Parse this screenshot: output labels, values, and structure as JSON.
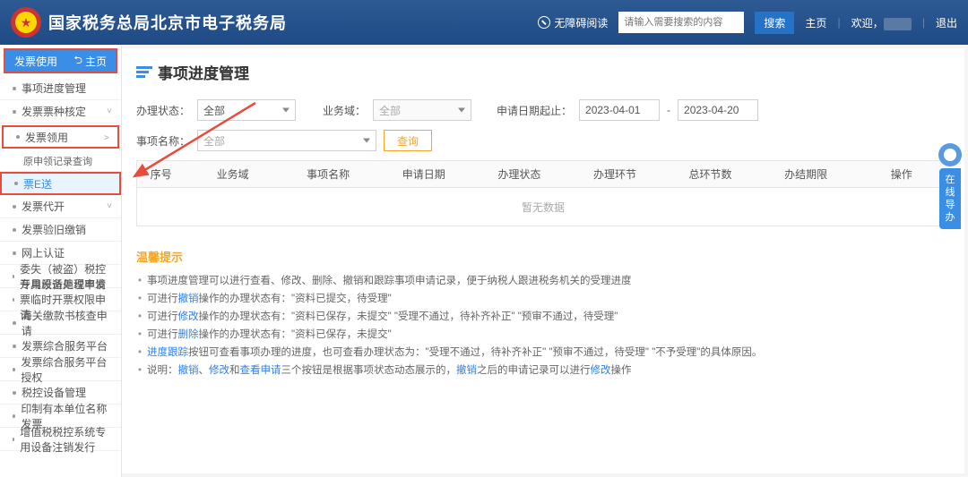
{
  "header": {
    "title": "国家税务总局北京市电子税务局",
    "wza": "无障碍阅读",
    "search_placeholder": "请输入需要搜索的内容",
    "search_btn": "搜索",
    "home": "主页",
    "welcome": "欢迎，",
    "logout": "退出"
  },
  "sidebar": {
    "group": "发票使用",
    "home": "主页",
    "items": [
      {
        "label": "事项进度管理",
        "type": "link"
      },
      {
        "label": "发票票种核定",
        "type": "expand"
      },
      {
        "label": "发票领用",
        "type": "expand_open"
      },
      {
        "label": "原申领记录查询",
        "type": "sub"
      },
      {
        "label": "票E送",
        "type": "highlight"
      },
      {
        "label": "发票代开",
        "type": "expand"
      },
      {
        "label": "发票验旧缴销",
        "type": "link"
      },
      {
        "label": "网上认证",
        "type": "link"
      },
      {
        "label": "委失（被盗）税控专用设备处理申请",
        "type": "link"
      },
      {
        "label": "开具原适用税率发票临时开票权限申请",
        "type": "link"
      },
      {
        "label": "海关缴款书核查申请",
        "type": "link"
      },
      {
        "label": "发票综合服务平台",
        "type": "link"
      },
      {
        "label": "发票综合服务平台授权",
        "type": "link"
      },
      {
        "label": "税控设备管理",
        "type": "link"
      },
      {
        "label": "印制有本单位名称发票",
        "type": "link"
      },
      {
        "label": "增值税税控系统专用设备注销发行",
        "type": "link"
      }
    ]
  },
  "page": {
    "title": "事项进度管理",
    "form": {
      "status_lbl": "办理状态：",
      "status_val": "全部",
      "biz_lbl": "业务域：",
      "biz_val": "全部",
      "date_lbl": "申请日期起止：",
      "date_from": "2023-04-01",
      "date_to": "2023-04-20",
      "date_sep": "-",
      "item_lbl": "事项名称：",
      "item_val": "全部",
      "query": "查询"
    },
    "table": {
      "headers": [
        "序号",
        "业务域",
        "事项名称",
        "申请日期",
        "办理状态",
        "办理环节",
        "总环节数",
        "办结期限",
        "操作"
      ],
      "empty": "暂无数据"
    },
    "tips": {
      "title": "温馨提示",
      "lines": [
        [
          {
            "t": "事项进度管理可以进行查看、修改、删除、撤销和跟踪事项申请记录，便于纳税人跟进税务机关的受理进度"
          }
        ],
        [
          {
            "t": "可进行"
          },
          {
            "t": "撤销",
            "k": 1
          },
          {
            "t": "操作的办理状态有：\"资料已提交，待受理\""
          }
        ],
        [
          {
            "t": "可进行"
          },
          {
            "t": "修改",
            "k": 1
          },
          {
            "t": "操作的办理状态有：\"资料已保存，未提交\" \"受理不通过，待补齐补正\" \"预审不通过，待受理\""
          }
        ],
        [
          {
            "t": "可进行"
          },
          {
            "t": "删除",
            "k": 1
          },
          {
            "t": "操作的办理状态有：\"资料已保存，未提交\""
          }
        ],
        [
          {
            "t": "进度跟踪",
            "k": 1
          },
          {
            "t": "按钮可查看事项办理的进度，也可查看办理状态为：\"受理不通过，待补齐补正\" \"预审不通过，待受理\" \"不予受理\"的具体原因。"
          }
        ],
        [
          {
            "t": "说明："
          },
          {
            "t": "撤销",
            "k": 1
          },
          {
            "t": "、"
          },
          {
            "t": "修改",
            "k": 1
          },
          {
            "t": "和"
          },
          {
            "t": "查看申请",
            "k": 1
          },
          {
            "t": "三个按钮是根据事项状态动态展示的，"
          },
          {
            "t": "撤销",
            "k": 1
          },
          {
            "t": "之后的申请记录可以进行"
          },
          {
            "t": "修改",
            "k": 1
          },
          {
            "t": "操作"
          }
        ]
      ]
    }
  },
  "float": "在线导办"
}
